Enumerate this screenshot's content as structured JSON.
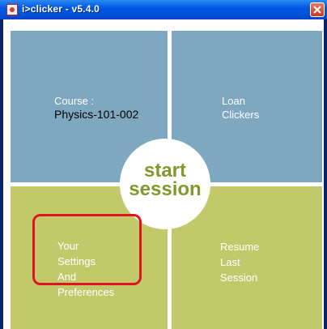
{
  "window": {
    "title": "i>clicker - v5.4.0",
    "icon": "iclicker-app-icon",
    "close_icon": "close-icon"
  },
  "colors": {
    "blue_tile": "#7da8bf",
    "green_tile": "#c2c96a",
    "start_text": "#7e9a2a",
    "highlight": "#e0141e"
  },
  "tiles": {
    "course_label": "Course :",
    "course_name": "Physics-101-002",
    "loan": "Loan\nClickers",
    "settings": "Your\nSettings\nAnd\nPreferences",
    "resume": "Resume\nLast\nSession"
  },
  "start": {
    "line1": "start",
    "line2": "session"
  }
}
